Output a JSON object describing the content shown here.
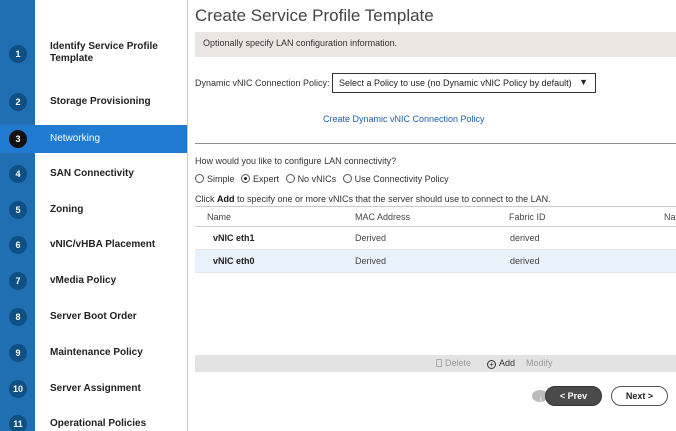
{
  "wizard": {
    "steps": [
      {
        "num": "1",
        "label": "Identify Service Profile Template"
      },
      {
        "num": "2",
        "label": "Storage Provisioning"
      },
      {
        "num": "3",
        "label": "Networking"
      },
      {
        "num": "4",
        "label": "SAN Connectivity"
      },
      {
        "num": "5",
        "label": "Zoning"
      },
      {
        "num": "6",
        "label": "vNIC/vHBA Placement"
      },
      {
        "num": "7",
        "label": "vMedia Policy"
      },
      {
        "num": "8",
        "label": "Server Boot Order"
      },
      {
        "num": "9",
        "label": "Maintenance Policy"
      },
      {
        "num": "10",
        "label": "Server Assignment"
      },
      {
        "num": "11",
        "label": "Operational Policies"
      }
    ],
    "active_step": "3"
  },
  "main": {
    "title": "Create Service Profile Template",
    "info_text": "Optionally specify LAN configuration information.",
    "policy_label": "Dynamic vNIC Connection Policy:",
    "policy_select_value": "Select a Policy to use (no Dynamic vNIC Policy by default)",
    "create_link": "Create Dynamic vNIC Connection Policy",
    "question": "How would you like to configure LAN connectivity?",
    "radio_options": [
      {
        "label": "Simple",
        "selected": false
      },
      {
        "label": "Expert",
        "selected": true
      },
      {
        "label": "No vNICs",
        "selected": false
      },
      {
        "label": "Use Connectivity Policy",
        "selected": false
      }
    ],
    "hint_prefix": "Click ",
    "hint_bold": "Add",
    "hint_suffix": " to specify one or more vNICs that the server should use to connect to the LAN."
  },
  "table": {
    "columns": [
      "Name",
      "MAC Address",
      "Fabric ID",
      "Na"
    ],
    "rows": [
      {
        "name": "vNIC eth1",
        "mac": "Derived",
        "fabric": "derived"
      },
      {
        "name": "vNIC eth0",
        "mac": "Derived",
        "fabric": "derived"
      }
    ]
  },
  "actions": {
    "delete": "Delete",
    "add": "Add",
    "modify": "Modify"
  },
  "buttons": {
    "prev": "< Prev",
    "next": "Next >"
  },
  "colors": {
    "rail": "#1f6fb2",
    "active_step": "#1f7ad0",
    "link": "#1f5fa8"
  }
}
